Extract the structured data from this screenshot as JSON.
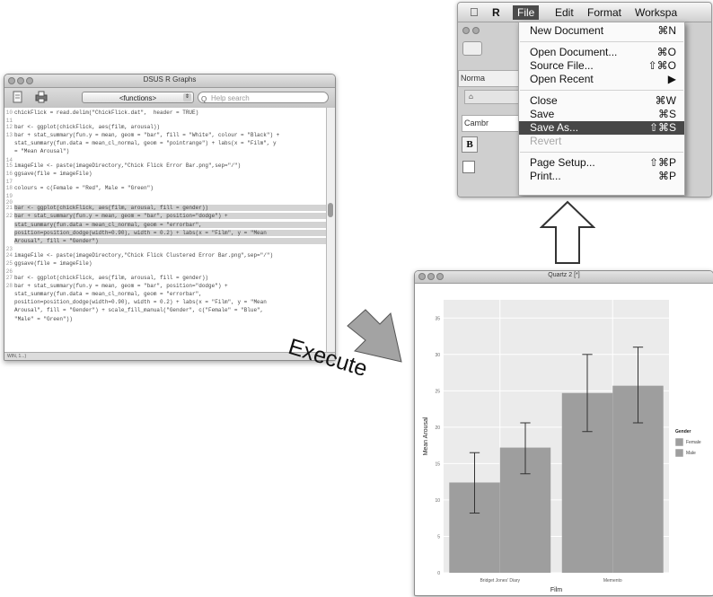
{
  "editor": {
    "title": "DSUS R Graphs",
    "functions_label": "<functions>",
    "search_placeholder": "Help search",
    "status": "WIN, 1...)",
    "lines": [
      {
        "n": "10",
        "t": "chickFlick = read.delim(\"ChickFlick.dat\",  header = TRUE)",
        "hl": false
      },
      {
        "n": "11",
        "t": "",
        "hl": false
      },
      {
        "n": "12",
        "t": "bar <- ggplot(chickFlick, aes(film, arousal))",
        "hl": false
      },
      {
        "n": "13",
        "t": "bar + stat_summary(fun.y = mean, geom = \"bar\", fill = \"White\", colour = \"Black\") +",
        "hl": false
      },
      {
        "n": "",
        "t": "stat_summary(fun.data = mean_cl_normal, geom = \"pointrange\") + labs(x = \"Film\", y",
        "hl": false
      },
      {
        "n": "",
        "t": "= \"Mean Arousal\")",
        "hl": false
      },
      {
        "n": "14",
        "t": "",
        "hl": false
      },
      {
        "n": "15",
        "t": "imageFile <- paste(imageDirectory,\"Chick Flick Error Bar.png\",sep=\"/\")",
        "hl": false
      },
      {
        "n": "16",
        "t": "ggsave(file = imageFile)",
        "hl": false
      },
      {
        "n": "17",
        "t": "",
        "hl": false
      },
      {
        "n": "18",
        "t": "colours = c(Female = \"Red\", Male = \"Green\")",
        "hl": false
      },
      {
        "n": "19",
        "t": "",
        "hl": false
      },
      {
        "n": "20",
        "t": "",
        "hl": false
      },
      {
        "n": "21",
        "t": "bar <- ggplot(chickFlick, aes(film, arousal, fill = gender))",
        "hl": true
      },
      {
        "n": "22",
        "t": "bar + stat_summary(fun.y = mean, geom = \"bar\", position=\"dodge\") +",
        "hl": true
      },
      {
        "n": "",
        "t": "stat_summary(fun.data = mean_cl_normal, geom = \"errorbar\",",
        "hl": true
      },
      {
        "n": "",
        "t": "position=position_dodge(width=0.90), width = 0.2) + labs(x = \"Film\", y = \"Mean",
        "hl": true
      },
      {
        "n": "",
        "t": "Arousal\", fill = \"Gender\")",
        "hl": true
      },
      {
        "n": "23",
        "t": "",
        "hl": false
      },
      {
        "n": "24",
        "t": "imageFile <- paste(imageDirectory,\"Chick Flick Clustered Error Bar.png\",sep=\"/\")",
        "hl": false
      },
      {
        "n": "25",
        "t": "ggsave(file = imageFile)",
        "hl": false
      },
      {
        "n": "26",
        "t": "",
        "hl": false
      },
      {
        "n": "27",
        "t": "bar <- ggplot(chickFlick, aes(film, arousal, fill = gender))",
        "hl": false
      },
      {
        "n": "28",
        "t": "bar + stat_summary(fun.y = mean, geom = \"bar\", position=\"dodge\") +",
        "hl": false
      },
      {
        "n": "",
        "t": "stat_summary(fun.data = mean_cl_normal, geom = \"errorbar\",",
        "hl": false
      },
      {
        "n": "",
        "t": "position=position_dodge(width=0.90), width = 0.2) + labs(x = \"Film\", y = \"Mean",
        "hl": false
      },
      {
        "n": "",
        "t": "Arousal\", fill = \"Gender\") + scale_fill_manual(\"Gender\", c(\"Female\" = \"Blue\",",
        "hl": false
      },
      {
        "n": "",
        "t": "\"Male\" = \"Green\"))",
        "hl": false
      }
    ]
  },
  "menu_window": {
    "menubar": [
      "R",
      "File",
      "Edit",
      "Format",
      "Workspa"
    ],
    "active": "File",
    "items": [
      {
        "label": "New Document",
        "shortcut": "⌘N",
        "state": "normal"
      },
      {
        "sep": true
      },
      {
        "label": "Open Document...",
        "shortcut": "⌘O",
        "state": "normal"
      },
      {
        "label": "Source File...",
        "shortcut": "⇧⌘O",
        "state": "normal"
      },
      {
        "label": "Open Recent",
        "shortcut": "▶",
        "state": "normal"
      },
      {
        "sep": true
      },
      {
        "label": "Close",
        "shortcut": "⌘W",
        "state": "normal"
      },
      {
        "label": "Save",
        "shortcut": "⌘S",
        "state": "normal"
      },
      {
        "label": "Save As...",
        "shortcut": "⇧⌘S",
        "state": "selected"
      },
      {
        "label": "Revert",
        "shortcut": "",
        "state": "disabled"
      },
      {
        "sep": true
      },
      {
        "label": "Page Setup...",
        "shortcut": "⇧⌘P",
        "state": "normal"
      },
      {
        "label": "Print...",
        "shortcut": "⌘P",
        "state": "normal"
      }
    ],
    "behind_fragments": [
      "Norma",
      "Cambr",
      "B"
    ]
  },
  "execute_label": "Execute",
  "plot_window": {
    "title": "Quartz 2 [*]"
  },
  "chart_data": {
    "type": "bar",
    "xlabel": "Film",
    "ylabel": "Mean Arousal",
    "categories": [
      "Bridget Jones' Diary",
      "Memento"
    ],
    "yticks": [
      0,
      5,
      10,
      15,
      20,
      25,
      30,
      35
    ],
    "ylim": [
      0,
      37.5
    ],
    "legend_title": "Gender",
    "legend_position": "right",
    "grid": true,
    "series": [
      {
        "name": "Female",
        "values": [
          12.4,
          24.7
        ],
        "err_low": [
          8.2,
          19.4
        ],
        "err_high": [
          16.5,
          30.0
        ],
        "color": "#9e9e9e"
      },
      {
        "name": "Male",
        "values": [
          17.2,
          25.7
        ],
        "err_low": [
          13.6,
          20.6
        ],
        "err_high": [
          20.6,
          31.0
        ],
        "color": "#9e9e9e"
      }
    ]
  }
}
